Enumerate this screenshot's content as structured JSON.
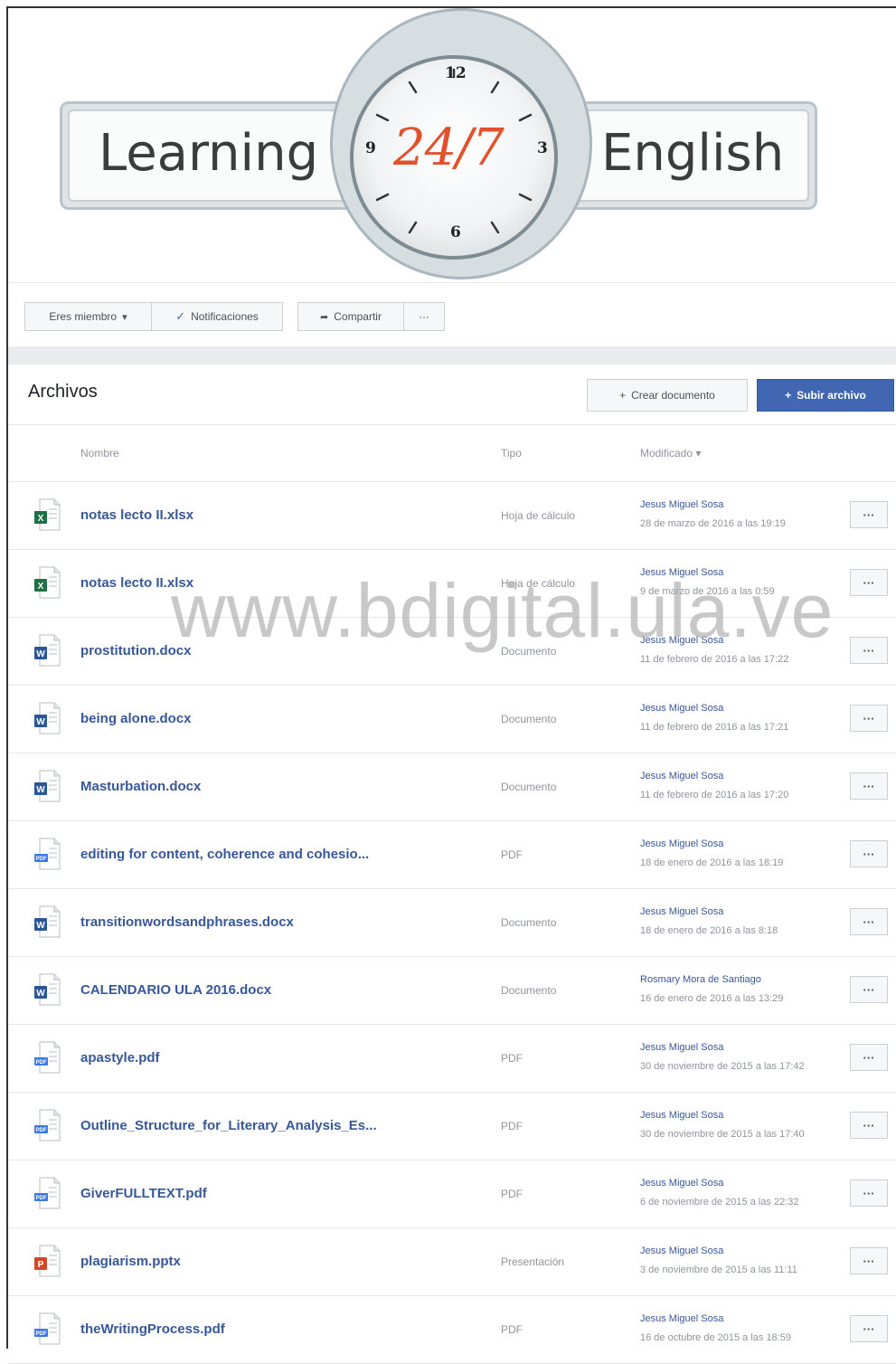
{
  "banner": {
    "word_left": "Learning",
    "center": "24/7",
    "word_right": "English",
    "clock_numbers": [
      "12",
      "3",
      "6",
      "9"
    ]
  },
  "actions": {
    "member_label": "Eres miembro",
    "notifications_label": "Notificaciones",
    "share_label": "Compartir",
    "more_label": "···"
  },
  "files": {
    "title": "Archivos",
    "create_label": "Crear documento",
    "upload_label": "Subir archivo",
    "columns": {
      "name": "Nombre",
      "type": "Tipo",
      "modified": "Modificado"
    },
    "more_label": "···",
    "rows": [
      {
        "name": "notas lecto II.xlsx",
        "type": "Hoja de cálculo",
        "author": "Jesus Miguel Sosa",
        "date": "28 de marzo de 2016 a las 19:19",
        "icon": "excel-icon"
      },
      {
        "name": "notas lecto II.xlsx",
        "type": "Hoja de cálculo",
        "author": "Jesus Miguel Sosa",
        "date": "9 de marzo de 2016 a las 0:59",
        "icon": "excel-icon"
      },
      {
        "name": "prostitution.docx",
        "type": "Documento",
        "author": "Jesus Miguel Sosa",
        "date": "11 de febrero de 2016 a las 17:22",
        "icon": "word-icon"
      },
      {
        "name": "being alone.docx",
        "type": "Documento",
        "author": "Jesus Miguel Sosa",
        "date": "11 de febrero de 2016 a las 17:21",
        "icon": "word-icon"
      },
      {
        "name": "Masturbation.docx",
        "type": "Documento",
        "author": "Jesus Miguel Sosa",
        "date": "11 de febrero de 2016 a las 17:20",
        "icon": "word-icon"
      },
      {
        "name": "editing for content, coherence and cohesio...",
        "type": "PDF",
        "author": "Jesus Miguel Sosa",
        "date": "18 de enero de 2016 a las 18:19",
        "icon": "pdf-icon"
      },
      {
        "name": "transitionwordsandphrases.docx",
        "type": "Documento",
        "author": "Jesus Miguel Sosa",
        "date": "18 de enero de 2016 a las 8:18",
        "icon": "word-icon"
      },
      {
        "name": "CALENDARIO ULA 2016.docx",
        "type": "Documento",
        "author": "Rosmary Mora de Santiago",
        "date": "16 de enero de 2016 a las 13:29",
        "icon": "word-icon"
      },
      {
        "name": "apastyle.pdf",
        "type": "PDF",
        "author": "Jesus Miguel Sosa",
        "date": "30 de noviembre de 2015 a las 17:42",
        "icon": "pdf-icon"
      },
      {
        "name": "Outline_Structure_for_Literary_Analysis_Es...",
        "type": "PDF",
        "author": "Jesus Miguel Sosa",
        "date": "30 de noviembre de 2015 a las 17:40",
        "icon": "pdf-icon"
      },
      {
        "name": "GiverFULLTEXT.pdf",
        "type": "PDF",
        "author": "Jesus Miguel Sosa",
        "date": "6 de noviembre de 2015 a las 22:32",
        "icon": "pdf-icon"
      },
      {
        "name": "plagiarism.pptx",
        "type": "Presentación",
        "author": "Jesus Miguel Sosa",
        "date": "3 de noviembre de 2015 a las 11:11",
        "icon": "powerpoint-icon"
      },
      {
        "name": "theWritingProcess.pdf",
        "type": "PDF",
        "author": "Jesus Miguel Sosa",
        "date": "16 de octubre de 2015 a las 18:59",
        "icon": "pdf-icon"
      }
    ]
  },
  "watermark": "www.bdigital.ula.ve",
  "colors": {
    "link": "#365899",
    "primary": "#4267b2",
    "excel": "#1e7145",
    "word": "#2b579a",
    "pdf": "#3b78e7",
    "powerpoint": "#d24726",
    "clock_accent": "#e2512b"
  }
}
